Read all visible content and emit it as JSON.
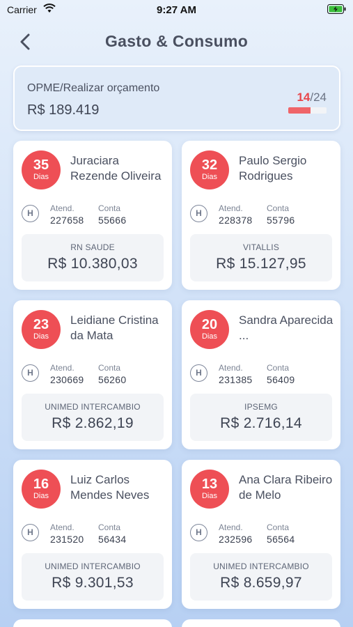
{
  "status_bar": {
    "carrier": "Carrier",
    "time": "9:27 AM"
  },
  "nav": {
    "title": "Gasto & Consumo"
  },
  "summary": {
    "label": "OPME/Realizar orçamento",
    "value": "R$ 189.419",
    "count_current": "14",
    "count_total": "/24",
    "progress_fraction": 0.58
  },
  "labels": {
    "atend": "Atend.",
    "conta": "Conta",
    "dias": "Dias",
    "hospital_letter": "H"
  },
  "cards": [
    {
      "days": "35",
      "name": "Juraciara Rezende Oliveira",
      "atend": "227658",
      "conta": "55666",
      "insurer": "RN SAUDE",
      "amount": "R$ 10.380,03"
    },
    {
      "days": "32",
      "name": "Paulo Sergio Rodrigues",
      "atend": "228378",
      "conta": "55796",
      "insurer": "VITALLIS",
      "amount": "R$ 15.127,95"
    },
    {
      "days": "23",
      "name": "Leidiane Cristina da Mata",
      "atend": "230669",
      "conta": "56260",
      "insurer": "UNIMED INTERCAMBIO",
      "amount": "R$ 2.862,19"
    },
    {
      "days": "20",
      "name": "Sandra Aparecida ...",
      "atend": "231385",
      "conta": "56409",
      "insurer": "IPSEMG",
      "amount": "R$ 2.716,14"
    },
    {
      "days": "16",
      "name": "Luiz Carlos Mendes Neves",
      "atend": "231520",
      "conta": "56434",
      "insurer": "UNIMED INTERCAMBIO",
      "amount": "R$ 9.301,53"
    },
    {
      "days": "13",
      "name": "Ana Clara Ribeiro de Melo",
      "atend": "232596",
      "conta": "56564",
      "insurer": "UNIMED INTERCAMBIO",
      "amount": "R$ 8.659,97"
    }
  ],
  "colors": {
    "badge": "#ee4f55",
    "accent_count": "#e8464b",
    "progress": "#ef6569"
  }
}
